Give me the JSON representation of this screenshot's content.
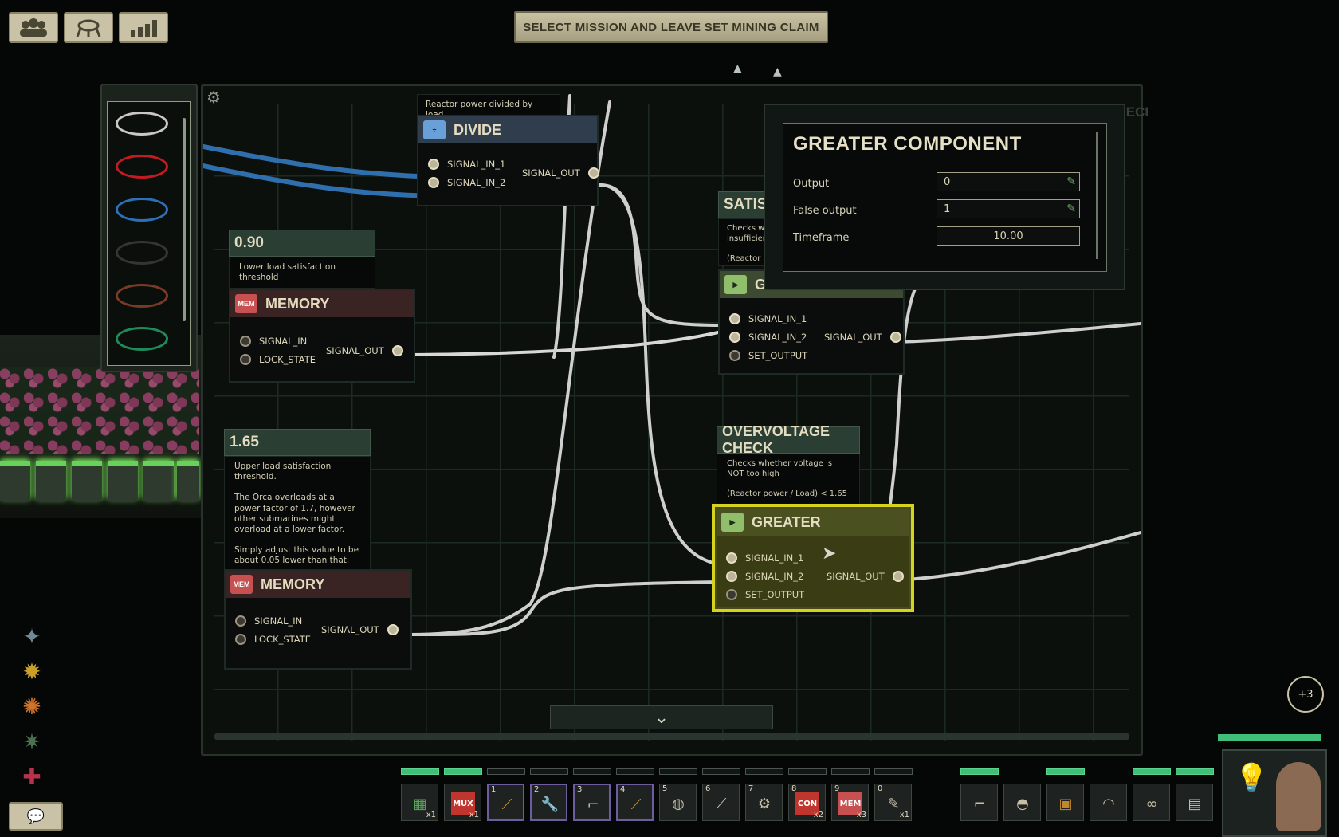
{
  "top_bar": {
    "crew_icon": "crew-icon",
    "mission_icon": "mission-icon",
    "stats_icon": "stats-icon",
    "mission_button_label": "SELECT MISSION AND LEAVE SET MINING CLAIM"
  },
  "wire_palette": {
    "colors": [
      "#c8c8c8",
      "#c41b22",
      "#2e6fb8",
      "#2a2a2a",
      "#7a3a26",
      "#1f8a5a"
    ]
  },
  "nodes": {
    "divide_desc": "Reactor power divided by load",
    "divide_title": "DIVIDE",
    "satisfaction_label": "SATISFACT",
    "satisfaction_desc_line1": "Checks whethe",
    "satisfaction_desc_line2": "insufficient",
    "satisfaction_desc_line3": "(Reactor",
    "lower_value": "0.90",
    "lower_desc": "Lower load satisfaction threshold",
    "memory_title": "MEMORY",
    "upper_value": "1.65",
    "upper_desc_1": "Upper load satisfaction threshold.",
    "upper_desc_2": "The Orca overloads at a power factor of 1.7, however other submarines might overload at a lower factor.",
    "upper_desc_3": "Simply adjust this value to be about 0.05 lower than that.",
    "overvoltage_title": "OVERVOLTAGE CHECK",
    "overvoltage_desc_1": "Checks whether voltage is NOT too high",
    "overvoltage_desc_2": "(Reactor power / Load) < 1.65",
    "greater_title": "GREATER",
    "greater_partial_title": "GREATER",
    "battery_label": "BATTERY MODE DECI"
  },
  "pins": {
    "signal_in_1": "SIGNAL_IN_1",
    "signal_in_2": "SIGNAL_IN_2",
    "signal_out": "SIGNAL_OUT",
    "signal_in": "SIGNAL_IN",
    "lock_state": "LOCK_STATE",
    "set_output": "SET_OUTPUT"
  },
  "properties": {
    "title": "GREATER COMPONENT",
    "output_label": "Output",
    "output_value": "0",
    "false_output_label": "False output",
    "false_output_value": "1",
    "timeframe_label": "Timeframe",
    "timeframe_value": "10.00"
  },
  "hotbar": {
    "slots": [
      {
        "num": "",
        "count": "x1",
        "icon": "circuit-icon"
      },
      {
        "num": "",
        "count": "x1",
        "icon": "mux-icon",
        "label": "MUX"
      },
      {
        "num": "1",
        "count": "",
        "icon": "screwdriver-icon"
      },
      {
        "num": "2",
        "count": "",
        "icon": "wrench-icon"
      },
      {
        "num": "3",
        "count": "",
        "icon": "gun-icon"
      },
      {
        "num": "4",
        "count": "",
        "icon": "screwdriver-icon"
      },
      {
        "num": "5",
        "count": "",
        "icon": "diving-mask-icon"
      },
      {
        "num": "6",
        "count": "",
        "icon": "flashlight-icon"
      },
      {
        "num": "7",
        "count": "",
        "icon": "welder-icon"
      },
      {
        "num": "8",
        "count": "x2",
        "icon": "concat-icon",
        "label": "CON"
      },
      {
        "num": "9",
        "count": "x3",
        "icon": "memory-chip-icon",
        "label": "MEM"
      },
      {
        "num": "0",
        "count": "x1",
        "icon": "syringe-icon"
      }
    ],
    "equip_slots": [
      "smg-icon",
      "helmet-icon",
      "armor-icon",
      "headset-icon",
      "goggles-icon",
      "id-card-icon"
    ]
  },
  "misc": {
    "plus_count": "+3",
    "collapse_icon": "chevron-down-icon",
    "chat_icon": "chat-icon",
    "settings_icon": "gear-icon"
  }
}
